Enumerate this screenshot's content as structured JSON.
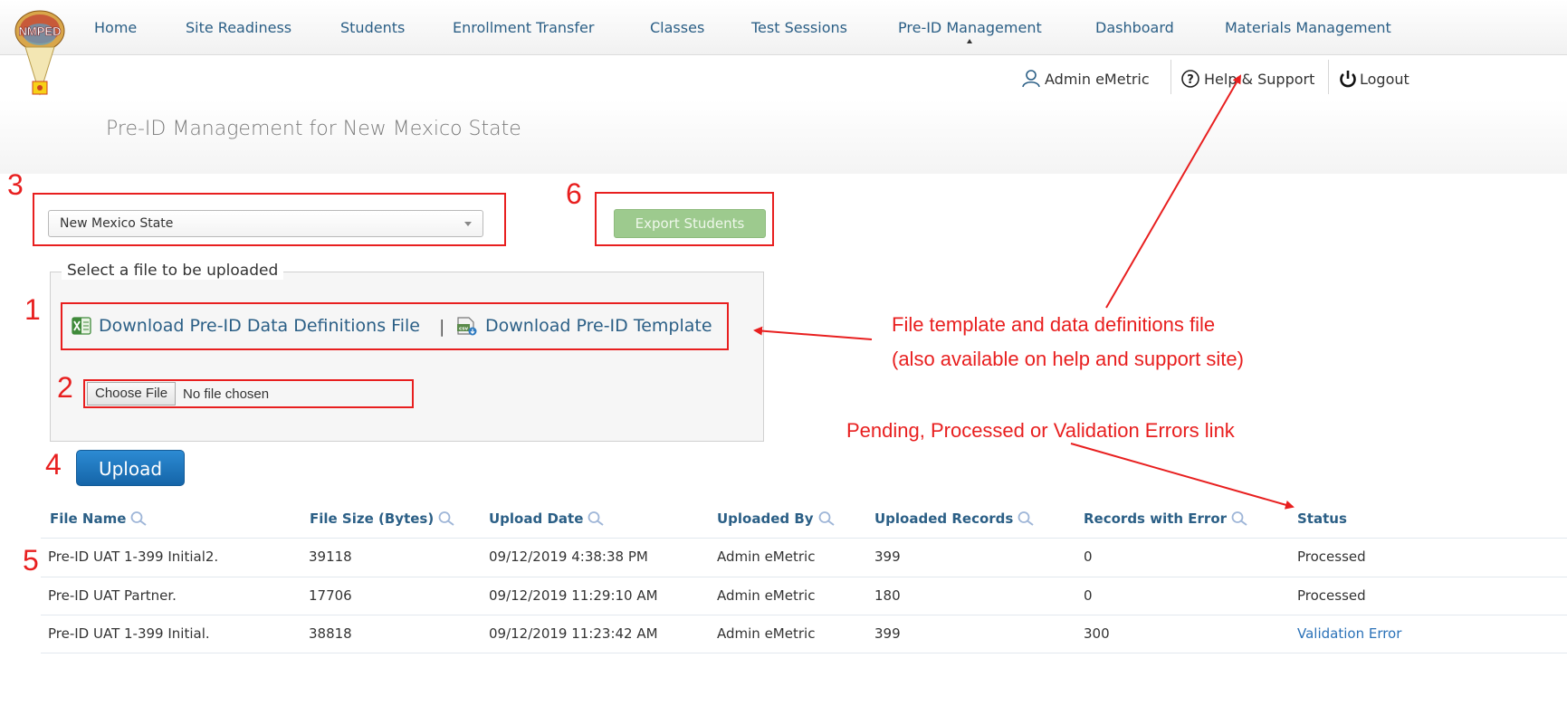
{
  "nav": {
    "items": [
      "Home",
      "Site Readiness",
      "Students",
      "Enrollment Transfer",
      "Classes",
      "Test Sessions",
      "Pre-ID Management",
      "Dashboard",
      "Materials Management"
    ],
    "active_index": 6
  },
  "logo": {
    "text": "NMPED"
  },
  "user_bar": {
    "user": "Admin eMetric",
    "help": "Help & Support",
    "logout": "Logout"
  },
  "page": {
    "title": "Pre-ID Management for New Mexico State"
  },
  "district_select": {
    "selected": "New Mexico State"
  },
  "export_button": "Export Students",
  "upload_panel": {
    "legend": "Select a file to be uploaded",
    "definitions_link": "Download Pre-ID Data Definitions File",
    "separator": "|",
    "template_link": "Download Pre-ID Template",
    "choose_file": "Choose File",
    "no_file": "No file chosen"
  },
  "upload_button": "Upload",
  "table": {
    "headers": [
      "File Name",
      "File Size (Bytes)",
      "Upload Date",
      "Uploaded By",
      "Uploaded Records",
      "Records with Error",
      "Status"
    ],
    "rows": [
      {
        "file": "Pre-ID UAT 1-399 Initial2.",
        "size": "39118",
        "date": "09/12/2019 4:38:38 PM",
        "by": "Admin eMetric",
        "records": "399",
        "errors": "0",
        "status": "Processed"
      },
      {
        "file": "Pre-ID UAT Partner.",
        "size": "17706",
        "date": "09/12/2019 11:29:10 AM",
        "by": "Admin eMetric",
        "records": "180",
        "errors": "0",
        "status": "Processed"
      },
      {
        "file": "Pre-ID UAT 1-399 Initial.",
        "size": "38818",
        "date": "09/12/2019 11:23:42 AM",
        "by": "Admin eMetric",
        "records": "399",
        "errors": "300",
        "status": "Validation Error"
      }
    ]
  },
  "annotations": {
    "numbers": [
      "1",
      "2",
      "3",
      "4",
      "5",
      "6"
    ],
    "template_note_line1": "File template and data definitions file",
    "template_note_line2": "(also available on help and support site)",
    "status_note": "Pending, Processed or Validation Errors link"
  },
  "colors": {
    "link": "#2b5f86",
    "annotation": "#e81f1f",
    "upload": "#1a74bd",
    "export": "#9dca8e"
  },
  "icons": [
    "user-icon",
    "help-icon",
    "power-icon",
    "excel-icon",
    "csv-icon",
    "magnifier-icon",
    "select-caret-icon"
  ]
}
